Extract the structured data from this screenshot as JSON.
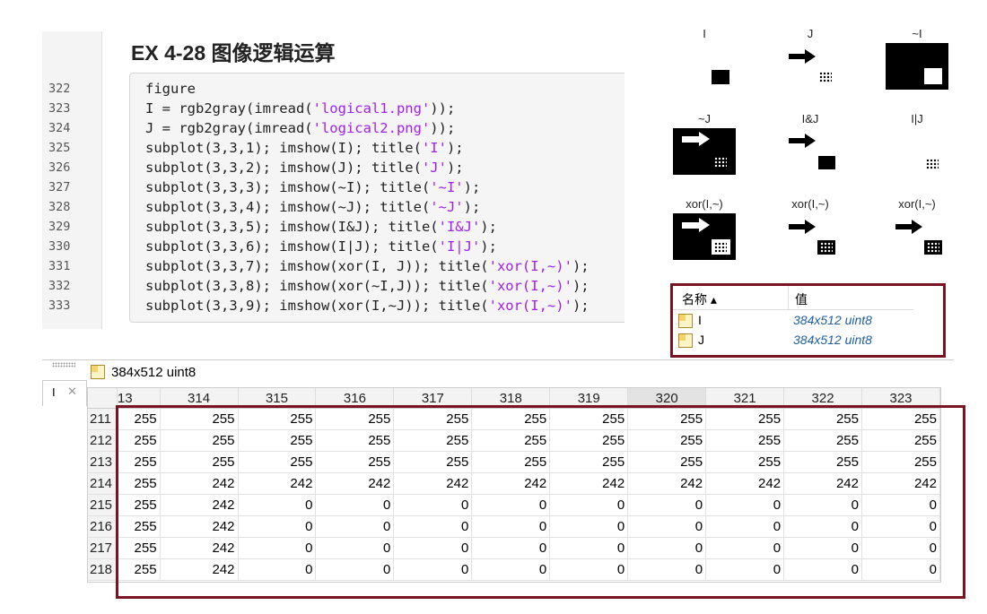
{
  "section_title": "EX 4-28 图像逻辑运算",
  "line_numbers": [
    "322",
    "323",
    "324",
    "325",
    "326",
    "327",
    "328",
    "329",
    "330",
    "331",
    "332",
    "333"
  ],
  "code_lines": [
    [
      {
        "t": "figure"
      }
    ],
    [
      {
        "t": "I = rgb2gray(imread("
      },
      {
        "t": "'logical1.png'",
        "s": 1
      },
      {
        "t": "));"
      }
    ],
    [
      {
        "t": "J = rgb2gray(imread("
      },
      {
        "t": "'logical2.png'",
        "s": 1
      },
      {
        "t": "));"
      }
    ],
    [
      {
        "t": "subplot(3,3,1); imshow(I); title("
      },
      {
        "t": "'I'",
        "s": 1
      },
      {
        "t": ");"
      }
    ],
    [
      {
        "t": "subplot(3,3,2); imshow(J); title("
      },
      {
        "t": "'J'",
        "s": 1
      },
      {
        "t": ");"
      }
    ],
    [
      {
        "t": "subplot(3,3,3); imshow(~I); title("
      },
      {
        "t": "'~I'",
        "s": 1
      },
      {
        "t": ");"
      }
    ],
    [
      {
        "t": "subplot(3,3,4); imshow(~J); title("
      },
      {
        "t": "'~J'",
        "s": 1
      },
      {
        "t": ");"
      }
    ],
    [
      {
        "t": "subplot(3,3,5); imshow(I&J); title("
      },
      {
        "t": "'I&J'",
        "s": 1
      },
      {
        "t": ");"
      }
    ],
    [
      {
        "t": "subplot(3,3,6); imshow(I|J); title("
      },
      {
        "t": "'I|J'",
        "s": 1
      },
      {
        "t": ");"
      }
    ],
    [
      {
        "t": "subplot(3,3,7); imshow(xor(I, J)); title("
      },
      {
        "t": "'xor(I,~)'",
        "s": 1
      },
      {
        "t": ");"
      }
    ],
    [
      {
        "t": "subplot(3,3,8); imshow(xor(~I,J)); title("
      },
      {
        "t": "'xor(I,~)'",
        "s": 1
      },
      {
        "t": ");"
      }
    ],
    [
      {
        "t": "subplot(3,3,9); imshow(xor(I,~J)); title("
      },
      {
        "t": "'xor(I,~)'",
        "s": 1
      },
      {
        "t": ");"
      }
    ]
  ],
  "subplots": {
    "titles": [
      "I",
      "J",
      "~I",
      "~J",
      "I&J",
      "I|J",
      "xor(I,~)",
      "xor(I,~)",
      "xor(I,~)"
    ]
  },
  "workspace": {
    "col_name": "名称 ▴",
    "col_value": "值",
    "rows": [
      {
        "name": "I",
        "value": "384x512 uint8"
      },
      {
        "name": "J",
        "value": "384x512 uint8"
      }
    ]
  },
  "variable_editor": {
    "title": "384x512 uint8",
    "tab_label": "I",
    "tab_close": "✕",
    "col_headers": [
      "13",
      "314",
      "315",
      "316",
      "317",
      "318",
      "319",
      "320",
      "321",
      "322",
      "323"
    ],
    "highlighted_col": "320",
    "rows": [
      {
        "r": "211",
        "v": [
          "255",
          "255",
          "255",
          "255",
          "255",
          "255",
          "255",
          "255",
          "255",
          "255",
          "255"
        ]
      },
      {
        "r": "212",
        "v": [
          "255",
          "255",
          "255",
          "255",
          "255",
          "255",
          "255",
          "255",
          "255",
          "255",
          "255"
        ]
      },
      {
        "r": "213",
        "v": [
          "255",
          "255",
          "255",
          "255",
          "255",
          "255",
          "255",
          "255",
          "255",
          "255",
          "255"
        ]
      },
      {
        "r": "214",
        "v": [
          "255",
          "242",
          "242",
          "242",
          "242",
          "242",
          "242",
          "242",
          "242",
          "242",
          "242"
        ]
      },
      {
        "r": "215",
        "v": [
          "255",
          "242",
          "0",
          "0",
          "0",
          "0",
          "0",
          "0",
          "0",
          "0",
          "0"
        ]
      },
      {
        "r": "216",
        "v": [
          "255",
          "242",
          "0",
          "0",
          "0",
          "0",
          "0",
          "0",
          "0",
          "0",
          "0"
        ]
      },
      {
        "r": "217",
        "v": [
          "255",
          "242",
          "0",
          "0",
          "0",
          "0",
          "0",
          "0",
          "0",
          "0",
          "0"
        ]
      },
      {
        "r": "218",
        "v": [
          "255",
          "242",
          "0",
          "0",
          "0",
          "0",
          "0",
          "0",
          "0",
          "0",
          "0"
        ]
      }
    ]
  }
}
